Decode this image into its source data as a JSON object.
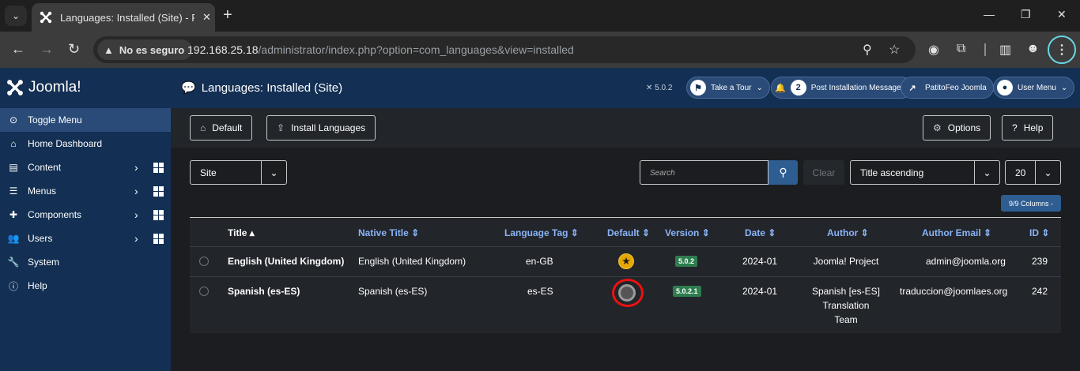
{
  "browser": {
    "tab_title": "Languages: Installed (Site) - PatitoFeo Joomla - Administración",
    "security_label": "No es seguro",
    "url_host": "192.168.25.18",
    "url_path": "/administrator/index.php?option=com_languages&view=installed"
  },
  "header": {
    "logo_text": "Joomla!",
    "page_title": "Languages: Installed (Site)",
    "version": "5.0.2",
    "take_tour": "Take a Tour",
    "post_install_count": "2",
    "post_install": "Post Installation Messages",
    "site_name": "PatitoFeo Joomla",
    "user_menu": "User Menu"
  },
  "sidebar": {
    "items": [
      {
        "label": "Toggle Menu",
        "icon": "toggle-icon"
      },
      {
        "label": "Home Dashboard",
        "icon": "home-icon"
      },
      {
        "label": "Content",
        "icon": "file-icon"
      },
      {
        "label": "Menus",
        "icon": "list-icon"
      },
      {
        "label": "Components",
        "icon": "puzzle-icon"
      },
      {
        "label": "Users",
        "icon": "users-icon"
      },
      {
        "label": "System",
        "icon": "wrench-icon"
      },
      {
        "label": "Help",
        "icon": "info-icon"
      }
    ]
  },
  "toolbar": {
    "default": "Default",
    "install": "Install Languages",
    "options": "Options",
    "help": "Help"
  },
  "filters": {
    "client": "Site",
    "search_placeholder": "Search",
    "clear": "Clear",
    "ordering": "Title ascending",
    "limit": "20",
    "columns": "9/9 Columns -"
  },
  "table": {
    "headers": [
      "Title",
      "Native Title",
      "Language Tag",
      "Default",
      "Version",
      "Date",
      "Author",
      "Author Email",
      "ID"
    ],
    "rows": [
      {
        "title": "English (United Kingdom)",
        "native": "English (United Kingdom)",
        "tag": "en-GB",
        "version": "5.0.2",
        "date": "2024-01",
        "author": [
          "Joomla! Project"
        ],
        "email": "admin@joomla.org",
        "id": "239"
      },
      {
        "title": "Spanish (es-ES)",
        "native": "Spanish (es-ES)",
        "tag": "es-ES",
        "version": "5.0.2.1",
        "date": "2024-01",
        "author": [
          "Spanish [es-ES]",
          "Translation",
          "Team"
        ],
        "email": "traduccion@joomlaes.org",
        "id": "242"
      }
    ]
  },
  "colors": {
    "header_bg": "#132f53",
    "accent": "#2e5d92",
    "badge_green": "#2e7d4f",
    "star": "#e6a700",
    "annotation_red": "#ee1111"
  }
}
